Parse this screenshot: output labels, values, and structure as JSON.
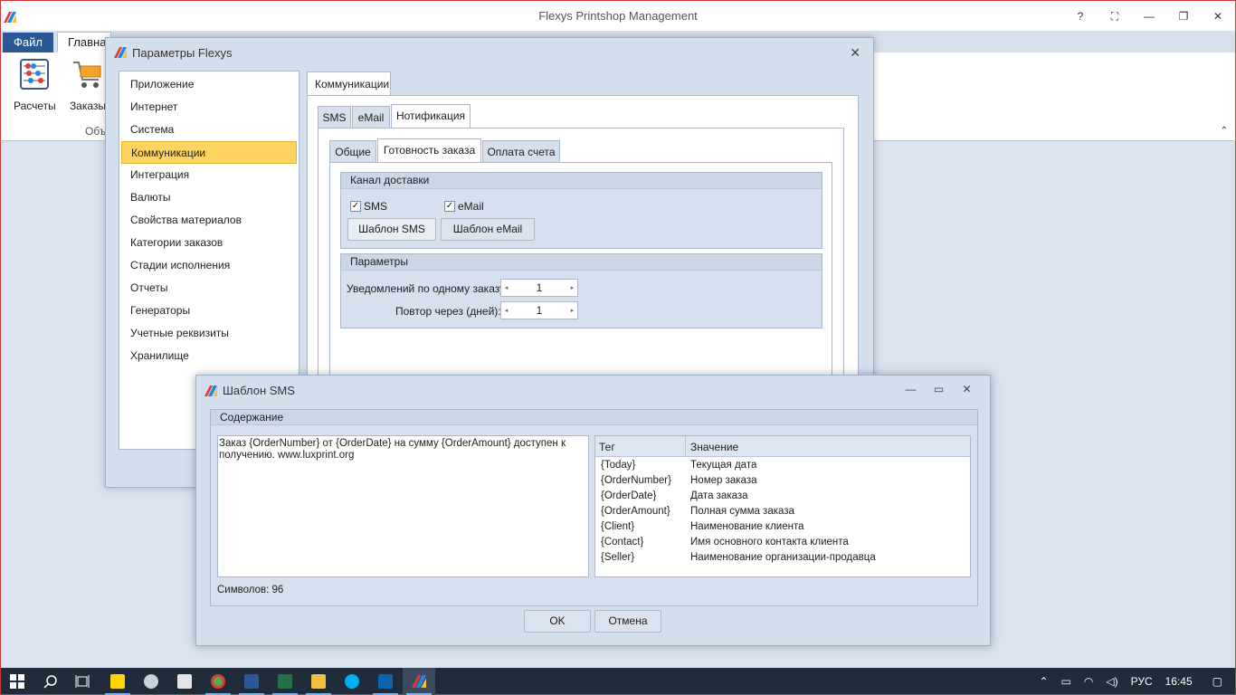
{
  "app": {
    "title": "Flexys Printshop Management",
    "file_tab": "Файл",
    "home_tab": "Главная",
    "ribbon_buttons": [
      "Расчеты",
      "Заказы"
    ],
    "ribbon_group": "Объ"
  },
  "params_dialog": {
    "title": "Параметры Flexys",
    "nav": [
      "Приложение",
      "Интернет",
      "Система",
      "Коммуникации",
      "Интеграция",
      "Валюты",
      "Свойства материалов",
      "Категории заказов",
      "Стадии исполнения",
      "Отчеты",
      "Генераторы",
      "Учетные реквизиты",
      "Хранилище"
    ],
    "selected_nav": "Коммуникации",
    "outer_tab": "Коммуникации",
    "channel_tabs": [
      "SMS",
      "eMail",
      "Нотификация"
    ],
    "notify_tabs": [
      "Общие",
      "Готовность заказа",
      "Оплата счета"
    ],
    "delivery": {
      "title": "Канал доставки",
      "sms_label": "SMS",
      "email_label": "eMail",
      "sms_template_btn": "Шаблон SMS",
      "email_template_btn": "Шаблон eMail"
    },
    "params": {
      "title": "Параметры",
      "per_order_label": "Уведомлений по одному заказу:",
      "per_order_value": "1",
      "repeat_label": "Повтор через (дней):",
      "repeat_value": "1"
    }
  },
  "sms_dialog": {
    "title": "Шаблон SMS",
    "content_title": "Содержание",
    "text": "Заказ {OrderNumber} от {OrderDate} на сумму {OrderAmount} доступен к получению. www.luxprint.org",
    "tags_header": {
      "tag": "Тег",
      "value": "Значение"
    },
    "tags": [
      {
        "tag": "{Today}",
        "value": "Текущая дата"
      },
      {
        "tag": "{OrderNumber}",
        "value": "Номер заказа"
      },
      {
        "tag": "{OrderDate}",
        "value": "Дата заказа"
      },
      {
        "tag": "{OrderAmount}",
        "value": "Полная сумма заказа"
      },
      {
        "tag": "{Client}",
        "value": "Наименование клиента"
      },
      {
        "tag": "{Contact}",
        "value": "Имя основного контакта клиента"
      },
      {
        "tag": "{Seller}",
        "value": "Наименование организации-продавца"
      }
    ],
    "char_count": "Символов: 96",
    "ok": "OK",
    "cancel": "Отмена"
  },
  "taskbar": {
    "lang": "РУС",
    "time": "16:45"
  },
  "colors": {
    "accent": "#2b5797",
    "selection": "#fcd45f"
  }
}
